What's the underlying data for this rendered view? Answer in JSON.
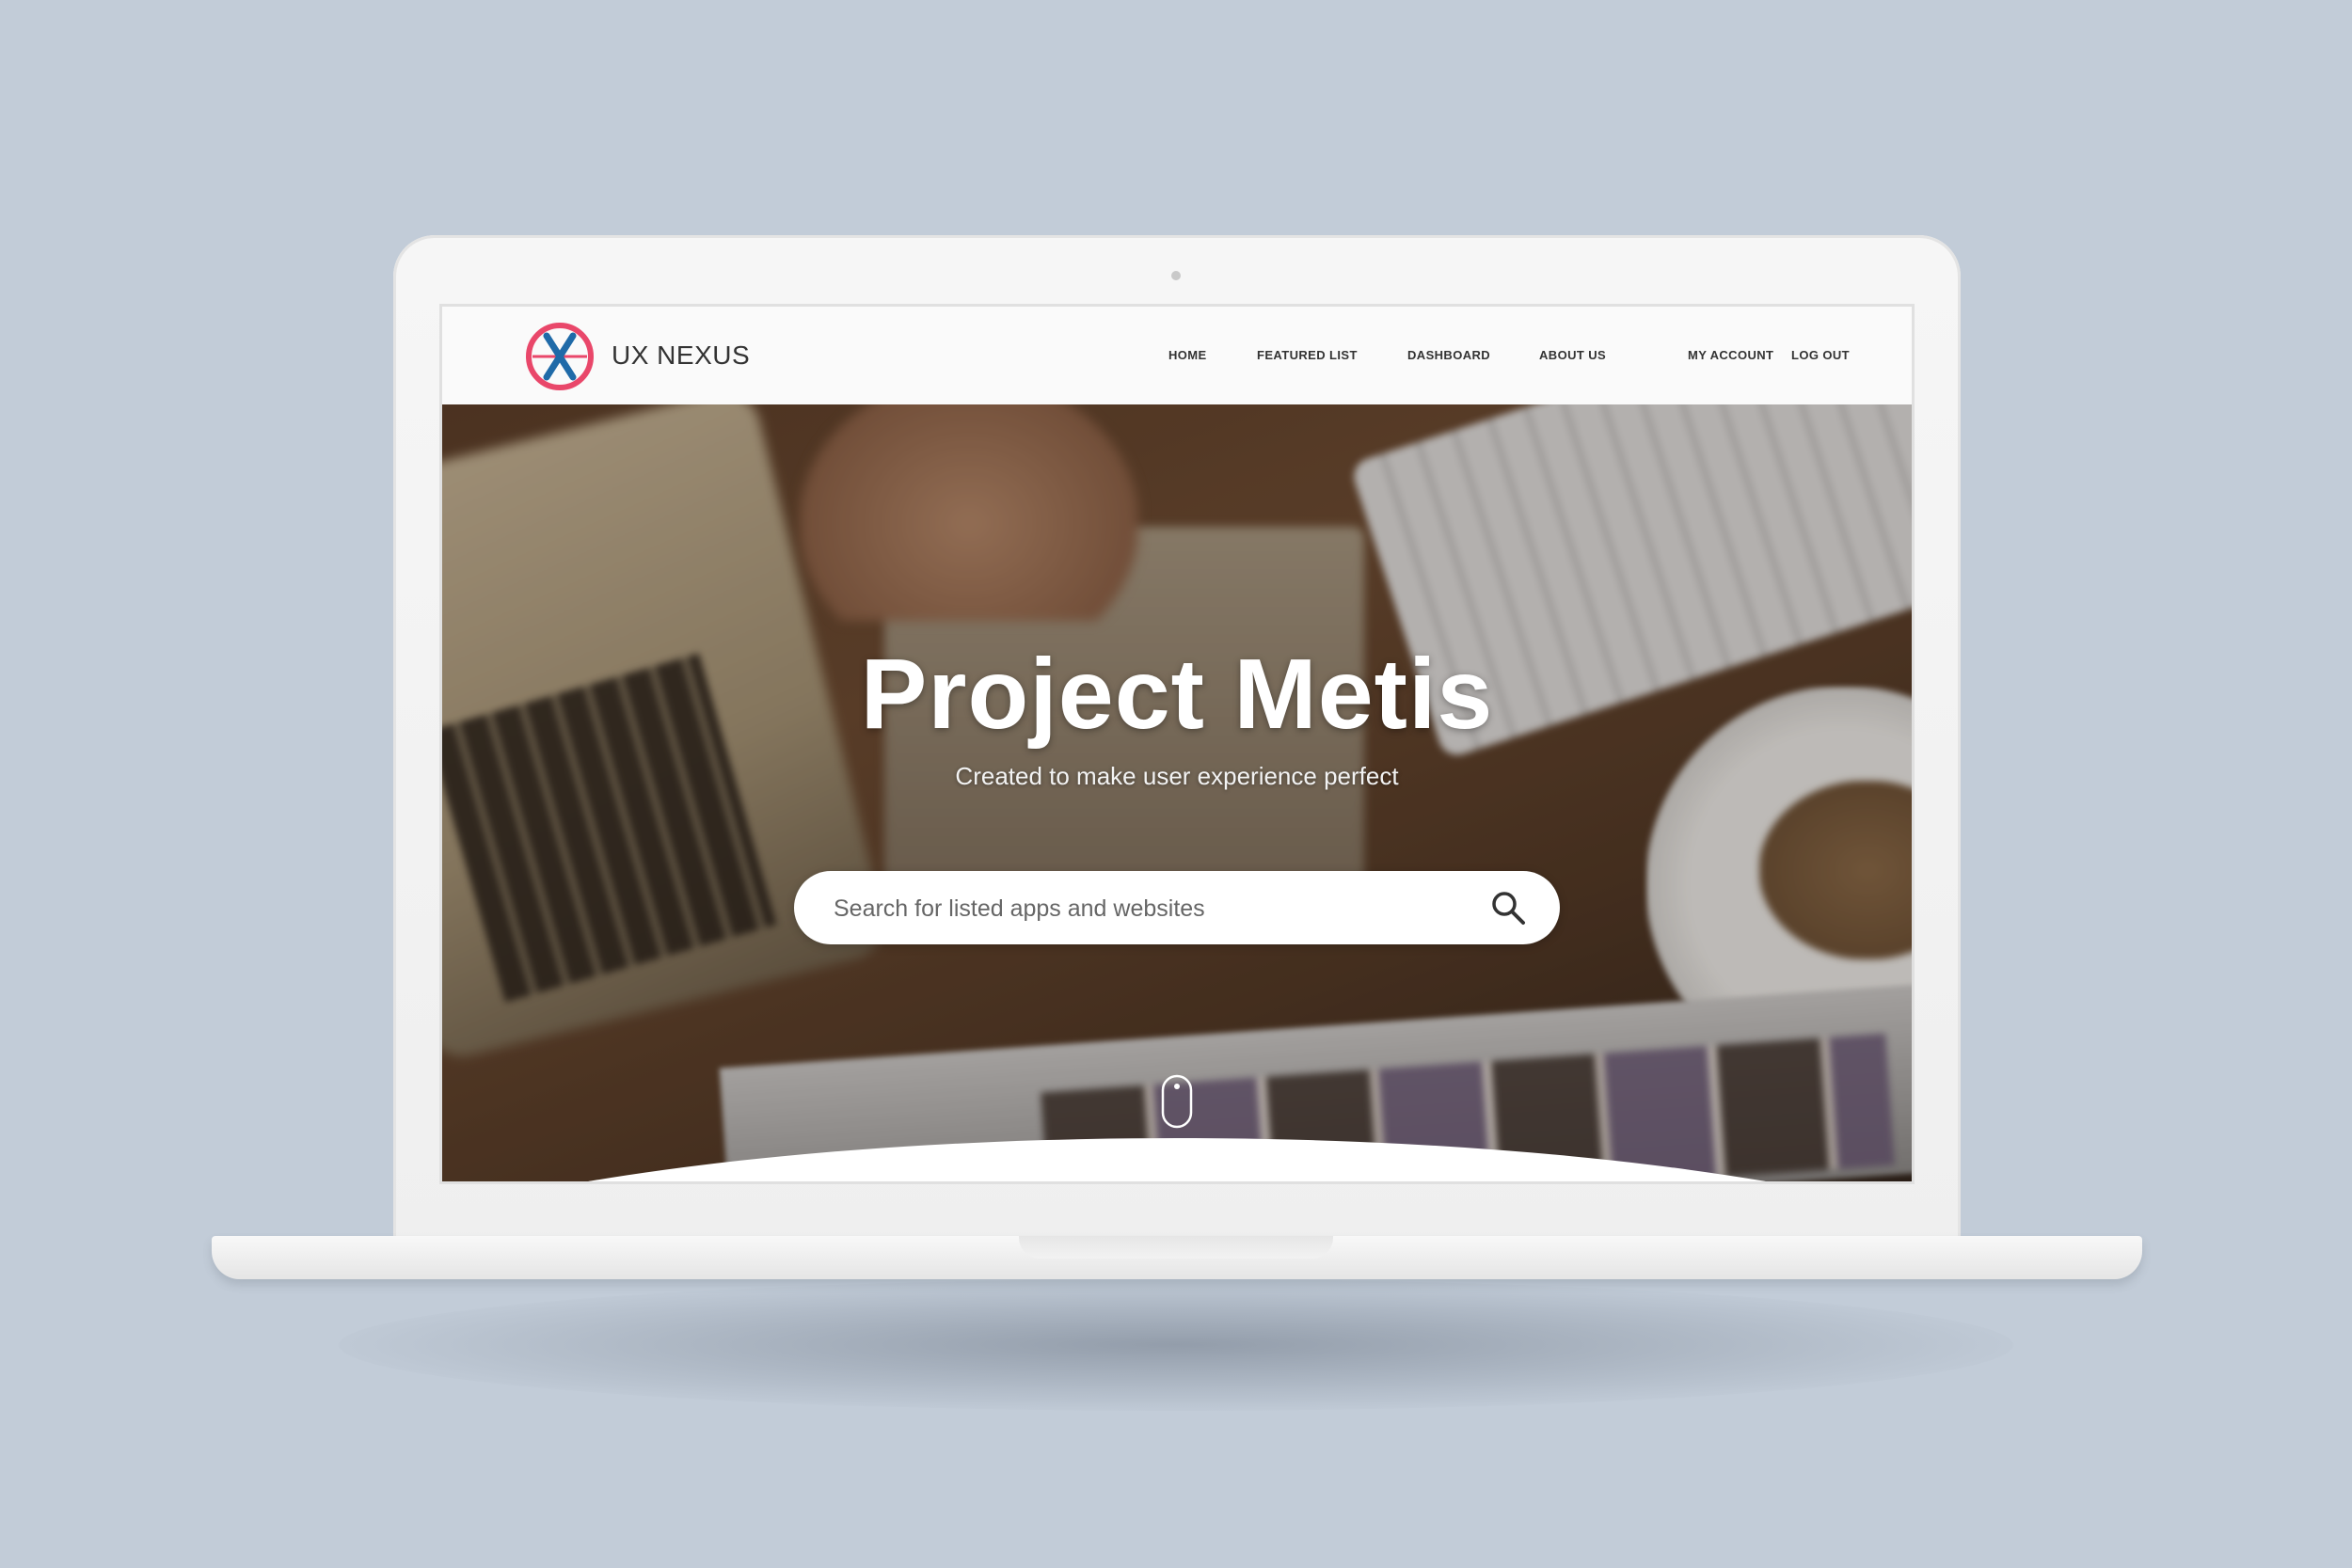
{
  "header": {
    "brand": "UX NEXUS",
    "nav": [
      "HOME",
      "FEATURED LIST",
      "DASHBOARD",
      "ABOUT US"
    ],
    "account": [
      "MY ACCOUNT",
      "LOG OUT"
    ]
  },
  "hero": {
    "title": "Project Metis",
    "subtitle": "Created to make user experience perfect"
  },
  "search": {
    "placeholder": "Search for listed apps and websites"
  },
  "colors": {
    "logo_ring": "#e9476a",
    "logo_x": "#1f6aa8",
    "background": "#c2ccd8"
  },
  "icons": [
    "uxnexus-logo-icon",
    "search-icon",
    "scroll-mouse-icon"
  ]
}
